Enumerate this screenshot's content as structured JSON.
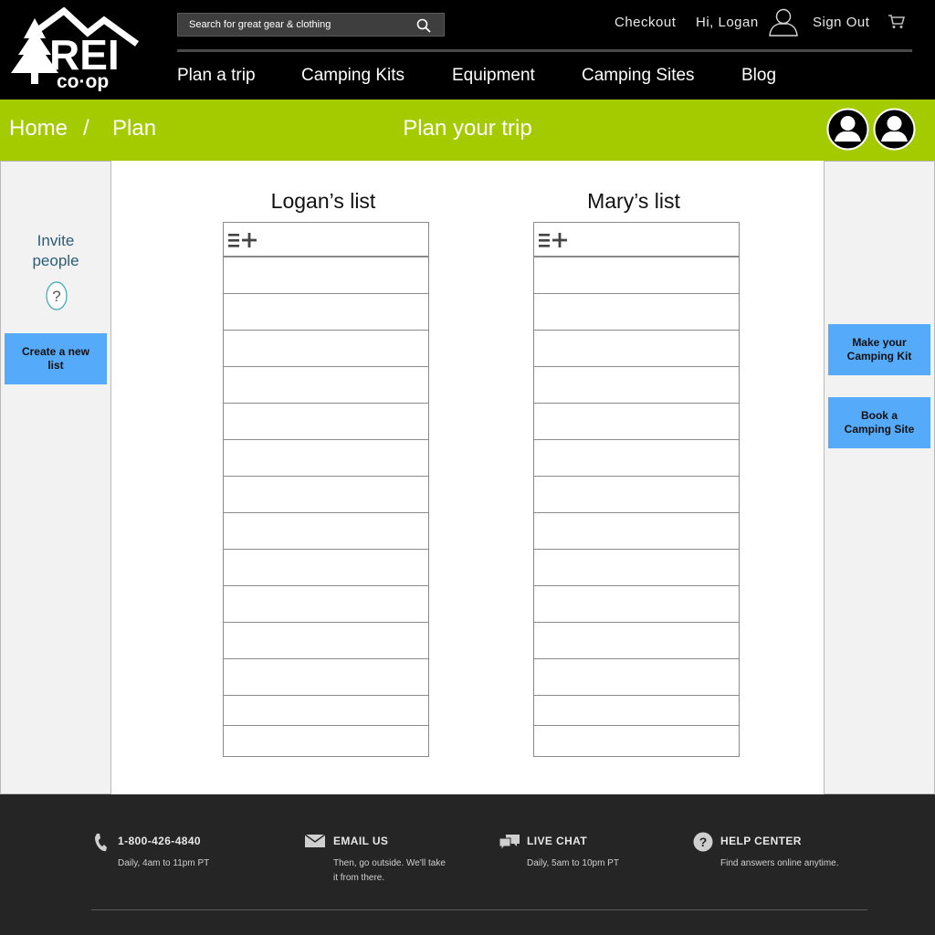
{
  "brand": {
    "logo_top": "REI",
    "logo_bottom": "co·op"
  },
  "search": {
    "placeholder": "Search for great gear & clothing"
  },
  "utility": {
    "checkout": "Checkout",
    "greeting": "Hi, Logan",
    "sign_out": "Sign Out"
  },
  "nav": [
    "Plan a trip",
    "Camping Kits",
    "Equipment",
    "Camping Sites",
    "Blog"
  ],
  "breadcrumb": {
    "home": "Home",
    "separator": "/",
    "current": "Plan"
  },
  "page_title": "Plan your trip",
  "left_panel": {
    "invite_line1": "Invite",
    "invite_line2": "people",
    "help_glyph": "?",
    "create_line1": "Create a new",
    "create_line2": "list"
  },
  "lists": [
    {
      "title": "Logan’s list",
      "items": [
        "",
        "",
        "",
        "",
        "",
        "",
        "",
        "",
        "",
        "",
        "",
        "",
        "",
        ""
      ]
    },
    {
      "title": "Mary’s list",
      "items": [
        "",
        "",
        "",
        "",
        "",
        "",
        "",
        "",
        "",
        "",
        "",
        "",
        "",
        ""
      ]
    }
  ],
  "right_panel": {
    "kit_line1": "Make your",
    "kit_line2": "Camping Kit",
    "site_line1": "Book a",
    "site_line2": "Camping Site"
  },
  "footer": [
    {
      "title": "1-800-426-4840",
      "desc1": "Daily, 4am to 11pm PT",
      "desc2": "",
      "icon": "phone-icon"
    },
    {
      "title": "EMAIL US",
      "desc1": "Then, go outside. We'll take",
      "desc2": "it from there.",
      "icon": "envelope-icon"
    },
    {
      "title": "LIVE CHAT",
      "desc1": "Daily, 5am to 10pm PT",
      "desc2": "",
      "icon": "chat-icon"
    },
    {
      "title": "HELP CENTER",
      "desc1": "Find answers online anytime.",
      "desc2": "",
      "icon": "help-circle-icon"
    }
  ],
  "colors": {
    "header_bg": "#000000",
    "accent_green": "#a3cb00",
    "button_blue": "#55aaf9",
    "footer_bg": "#252525",
    "invite_text": "#2a5d79"
  }
}
